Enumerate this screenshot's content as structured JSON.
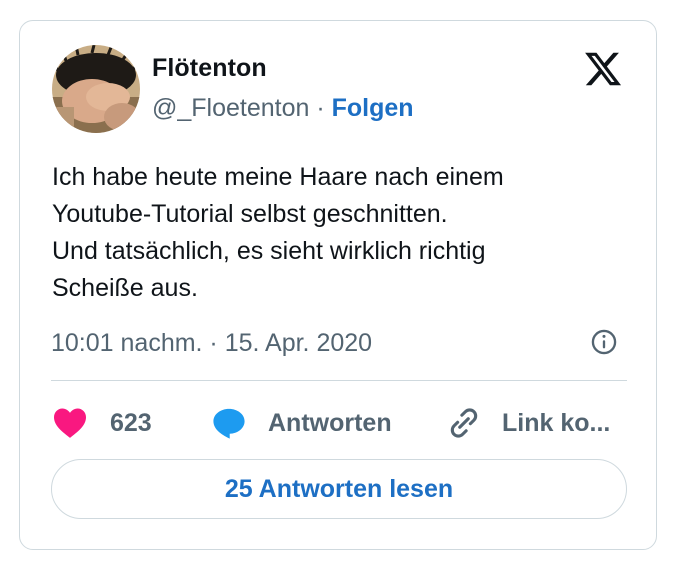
{
  "author": {
    "display_name": "Flötenton",
    "handle": "@_Floetenton",
    "separator": " · ",
    "follow_label": "Folgen"
  },
  "tweet": {
    "lines": [
      "Ich habe heute meine Haare nach einem",
      "Youtube-Tutorial selbst geschnitten.",
      "Und tatsächlich, es sieht wirklich richtig",
      "Scheiße aus."
    ],
    "timestamp": "10:01 nachm. · 15. Apr. 2020"
  },
  "actions": {
    "like_count": "623",
    "reply_label": "Antworten",
    "copy_link_label": "Link ko..."
  },
  "read_replies_label": "25 Antworten lesen",
  "icons": {
    "logo": "x-logo-icon",
    "info": "info-icon",
    "like": "heart-icon",
    "reply": "speech-bubble-icon",
    "copy": "link-icon"
  },
  "colors": {
    "text": "#0f1419",
    "secondary": "#536471",
    "link": "#1d6fc4",
    "heart": "#f91880",
    "reply_bubble": "#1d9bf0",
    "border": "#cfd9de"
  }
}
